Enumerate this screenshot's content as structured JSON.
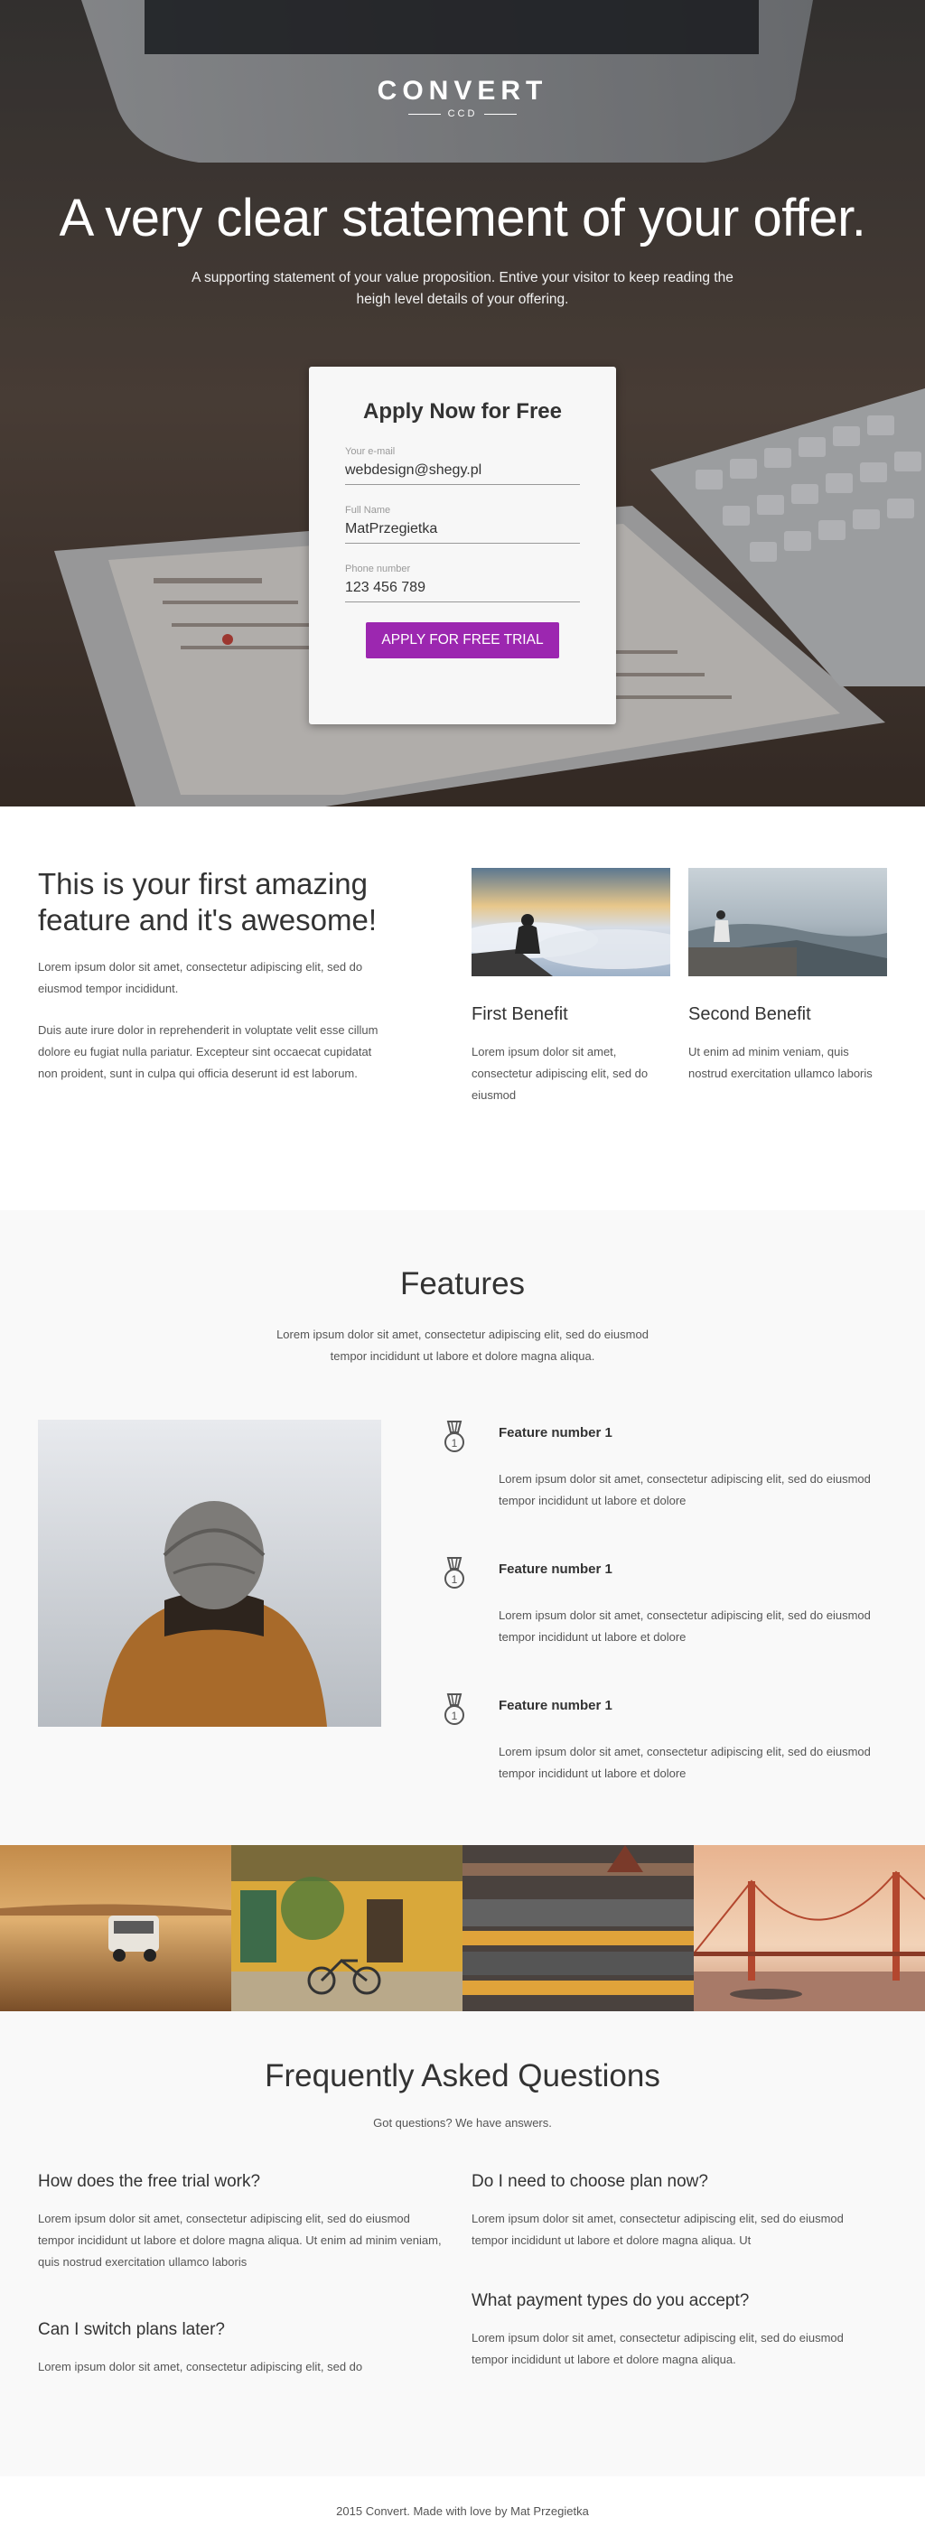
{
  "hero": {
    "logo_main": "CONVERT",
    "logo_sub": "CCD",
    "title": "A very clear statement of your offer.",
    "subtitle": "A supporting statement of your value proposition. Entive your visitor to keep reading the heigh level details of your offering."
  },
  "form": {
    "title": "Apply Now for Free",
    "email_label": "Your e-mail",
    "email_value": "webdesign@shegy.pl",
    "name_label": "Full Name",
    "name_value": "MatPrzegietka",
    "phone_label": "Phone number",
    "phone_value": "123 456 789",
    "button_label": "APPLY FOR FREE TRIAL",
    "button_color": "#9c27b0"
  },
  "intro": {
    "heading": "This is your first amazing feature and it's awesome!",
    "paragraph1": "Lorem ipsum dolor sit amet, consectetur adipiscing elit, sed do eiusmod tempor incididunt.",
    "paragraph2": "Duis aute irure dolor in reprehenderit in voluptate velit esse cillum dolore eu fugiat nulla pariatur. Excepteur sint occaecat cupidatat non proident, sunt in culpa qui officia deserunt id est laborum.",
    "benefits": [
      {
        "title": "First Benefit",
        "text": "Lorem ipsum dolor sit amet, consectetur adipiscing elit, sed do eiusmod"
      },
      {
        "title": "Second Benefit",
        "text": "Ut enim ad minim veniam, quis nostrud exercitation ullamco laboris"
      }
    ]
  },
  "features": {
    "title": "Features",
    "subtitle": "Lorem ipsum dolor sit amet, consectetur adipiscing elit, sed do eiusmod tempor incididunt ut labore et dolore magna aliqua.",
    "items": [
      {
        "name": "Feature number 1",
        "desc": "Lorem ipsum dolor sit amet, consectetur adipiscing elit, sed do eiusmod tempor incididunt ut labore et dolore"
      },
      {
        "name": "Feature number 1",
        "desc": "Lorem ipsum dolor sit amet, consectetur adipiscing elit, sed do eiusmod tempor incididunt ut labore et dolore"
      },
      {
        "name": "Feature number 1",
        "desc": "Lorem ipsum dolor sit amet, consectetur adipiscing elit, sed do eiusmod tempor incididunt ut labore et dolore"
      }
    ],
    "icon": "medal-icon"
  },
  "faq": {
    "title": "Frequently Asked Questions",
    "subtitle": "Got questions? We have answers.",
    "items": [
      {
        "q": "How does the free trial work?",
        "a": "Lorem ipsum dolor sit amet, consectetur adipiscing elit, sed do eiusmod tempor incididunt ut labore et dolore magna aliqua. Ut enim ad minim veniam, quis nostrud exercitation ullamco laboris"
      },
      {
        "q": "Do I need to choose plan now?",
        "a": "Lorem ipsum dolor sit amet, consectetur adipiscing elit, sed do eiusmod tempor incididunt ut labore et dolore magna aliqua. Ut"
      },
      {
        "q": "Can I switch plans later?",
        "a": "Lorem ipsum dolor sit amet, consectetur adipiscing elit, sed do"
      },
      {
        "q": "What payment types do you accept?",
        "a": "Lorem ipsum dolor sit amet, consectetur adipiscing elit, sed do eiusmod tempor incididunt ut labore et dolore magna aliqua."
      }
    ]
  },
  "footer": {
    "text": "2015 Convert. Made with love by Mat Przegietka"
  }
}
